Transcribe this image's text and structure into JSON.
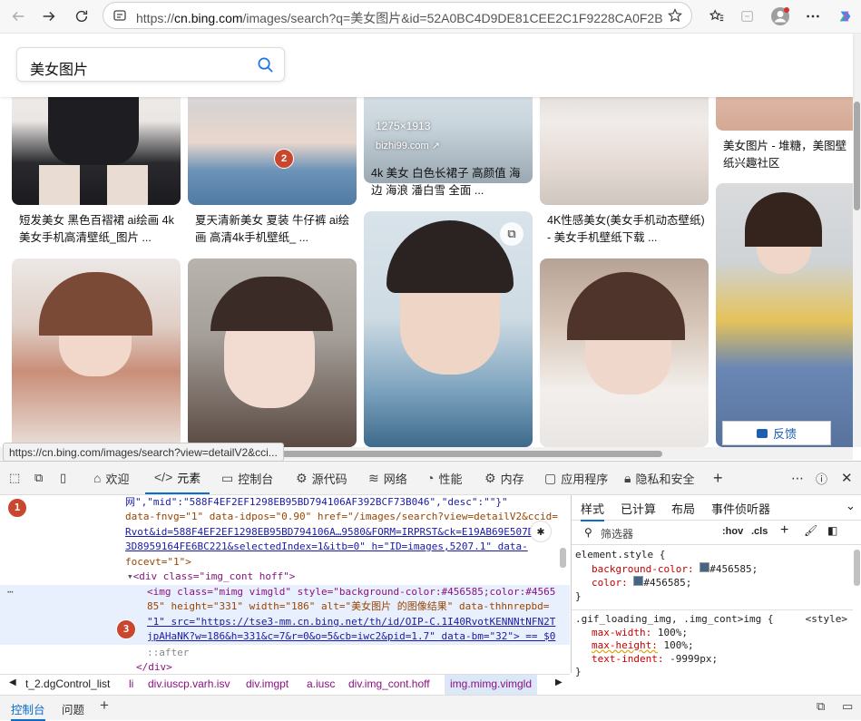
{
  "browser": {
    "url_prefix": "https://",
    "url_host": "cn.bing.com",
    "url_rest": "/images/search?q=美女图片&id=52A0BC4D9DE81CEE2C1F9228CA0F2B...",
    "status_url": "https://cn.bing.com/images/search?view=detailV2&cci..."
  },
  "search": {
    "query": "美女图片"
  },
  "results": [
    {
      "caption": "短发美女 黑色百褶裙 ai绘画 4k美女手机高清壁纸_图片 ..."
    },
    {
      "caption": "夏天清新美女 夏装 牛仔裤 ai绘画 高清4k手机壁纸_ ..."
    },
    {
      "caption": "4k 美女 白色长裙子 高颜值 海边 海浪 潘白雪 全面 ...",
      "size": "1275×1913",
      "source": "bizhi99.com"
    },
    {
      "caption": "4K性感美女(美女手机动态壁纸) - 美女手机壁纸下载 ..."
    },
    {
      "caption": "美女图片 - 堆糖，美图壁纸兴趣社区"
    }
  ],
  "feedback_label": "反馈",
  "badges": [
    "1",
    "2",
    "3"
  ],
  "devtools": {
    "tabs": [
      "欢迎",
      "元素",
      "控制台",
      "源代码",
      "网络",
      "性能",
      "内存",
      "应用程序",
      "隐私和安全"
    ],
    "dom_lines": [
      "网\",\"mid\":\"588F4EF2EF1298EB95BD794106AF392BCF73B046\",\"desc\":\"\"}\"",
      "data-fnvg=\"1\" data-idpos=\"0.90\" href=\"/images/search?view=detailV2&ccid=",
      "Rvot&id=588F4EF2EF1298EB95BD794106A…9580&FORM=IRPRST&ck=E19AB69E507D",
      "3D8959164FE6BC221&selectedIndex=1&itb=0\" h=\"ID=images,5207.1\" data-",
      "focevt=\"1\">",
      "<div class=\"img_cont hoff\">",
      "<img class=\"mimg vimgld\" style=\"background-color:#456585;color:#4565",
      "85\" height=\"331\" width=\"186\" alt=\"美女图片 的图像结果\" data-thhnrepbd=",
      "\"1\" src=\"https://tse3-mm.cn.bing.net/th/id/OIP-C.1I40RvotKENNNtNFN2T",
      "jpAHaNK?w=186&h=331&c=7&r=0&o=5&cb=iwc2&pid=1.7\" data-bm=\"32\"> == $0",
      "::after",
      "</div>"
    ],
    "styles_tabs": [
      "样式",
      "已计算",
      "布局",
      "事件侦听器"
    ],
    "filter_placeholder": "筛选器",
    "filter_buttons": [
      ":hov",
      ".cls"
    ],
    "rules": {
      "element_selector": "element.style {",
      "bg_prop": "background-color:",
      "bg_val": "#456585;",
      "color_prop": "color:",
      "color_val": "#456585;",
      "close": "}",
      "gif_selector": ".gif_loading_img, .img_cont>img {",
      "gif_source": "<style>",
      "maxw_prop": "max-width:",
      "maxw_val": "100%;",
      "maxh_prop": "max-height:",
      "maxh_val": "100%;",
      "ti_prop": "text-indent:",
      "ti_val": "-9999px;"
    },
    "breadcrumbs": [
      "t_2.dgControl_list",
      "li",
      "div.iuscp.varh.isv",
      "div.imgpt",
      "a.iusc",
      "div.img_cont.hoff",
      "img.mimg.vimgld"
    ],
    "bottom_tabs": [
      "控制台",
      "问题"
    ],
    "swatch_color": "#456585"
  }
}
